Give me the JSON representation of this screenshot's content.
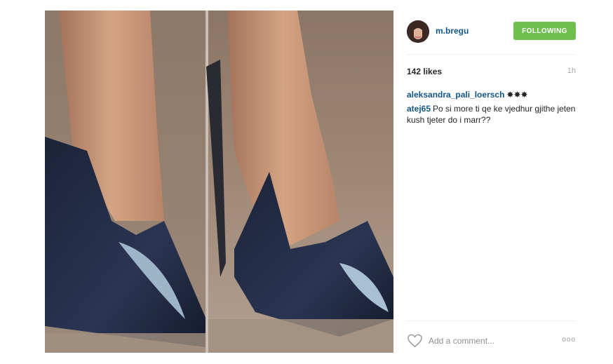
{
  "post": {
    "image_alt": "shoes photo"
  },
  "header": {
    "username": "m.bregu",
    "follow_label": "FOLLOWING"
  },
  "meta": {
    "likes": "142 likes",
    "time": "1h"
  },
  "comments": [
    {
      "user": "aleksandra_pali_loersch",
      "text": "✸✸✸"
    },
    {
      "user": "atej65",
      "text": "Po si more ti qe ke vjedhur gjithe jeten kush tjeter do i marr??"
    }
  ],
  "footer": {
    "comment_placeholder": "Add a comment...",
    "more_glyph": "ooo"
  },
  "colors": {
    "username": "#125688",
    "follow_button": "#70c050",
    "text": "#262626"
  },
  "icons": [
    "heart-icon",
    "more-options-icon"
  ]
}
